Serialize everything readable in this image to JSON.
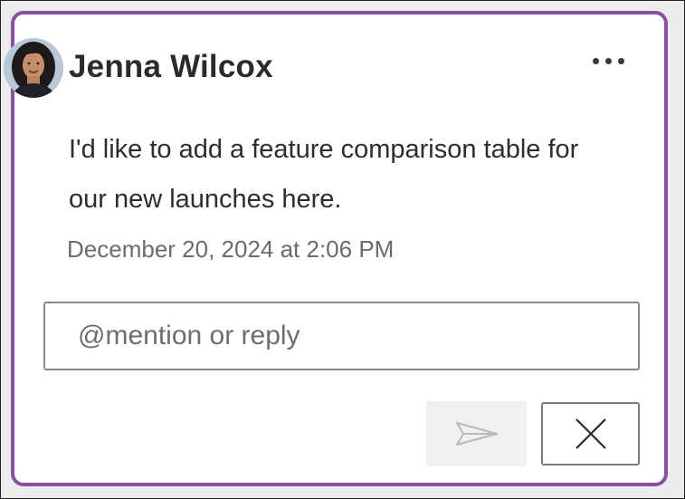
{
  "comment": {
    "author": "Jenna Wilcox",
    "text": "I'd like to add a feature comparison table for our new launches here.",
    "timestamp": "December 20, 2024 at 2:06 PM"
  },
  "reply": {
    "placeholder": "@mention or reply",
    "value": ""
  },
  "icons": {
    "more": "more-options-icon",
    "send": "send-icon",
    "cancel": "close-icon",
    "avatar": "user-avatar"
  },
  "colors": {
    "accent_border": "#8a4ea3",
    "author_text": "#2b2b2b",
    "timestamp_text": "#6b6b6b",
    "send_disabled_bg": "#f0f0f0"
  }
}
